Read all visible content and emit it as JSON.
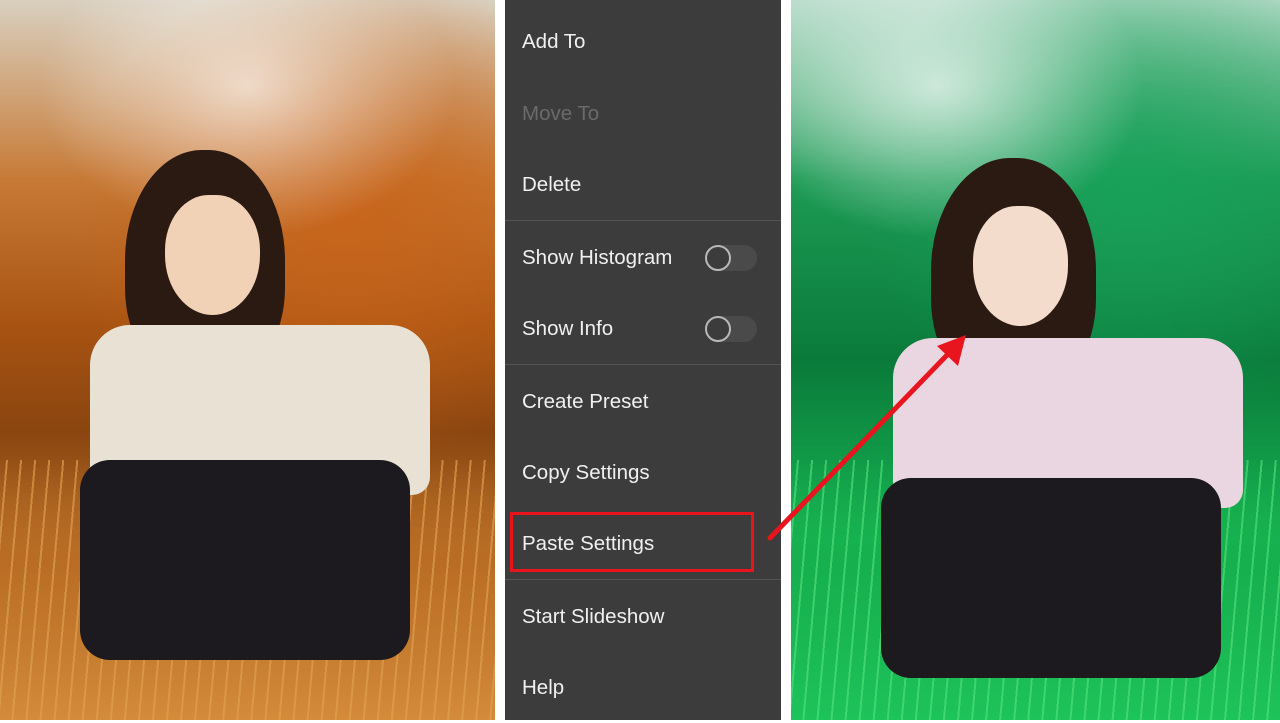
{
  "menu": {
    "items": [
      {
        "label": "Add To",
        "enabled": true
      },
      {
        "label": "Move To",
        "enabled": false
      },
      {
        "label": "Delete",
        "enabled": true
      },
      {
        "label": "Show Histogram",
        "enabled": true,
        "toggle": false
      },
      {
        "label": "Show Info",
        "enabled": true,
        "toggle": false
      },
      {
        "label": "Create Preset",
        "enabled": true
      },
      {
        "label": "Copy Settings",
        "enabled": true
      },
      {
        "label": "Paste Settings",
        "enabled": true,
        "highlighted": true
      },
      {
        "label": "Start Slideshow",
        "enabled": true
      },
      {
        "label": "Help",
        "enabled": true
      }
    ]
  },
  "colors": {
    "menu_background": "#3c3c3c",
    "highlight": "#e8141e",
    "arrow": "#e8141e",
    "left_tone": "orange",
    "right_tone": "green"
  }
}
